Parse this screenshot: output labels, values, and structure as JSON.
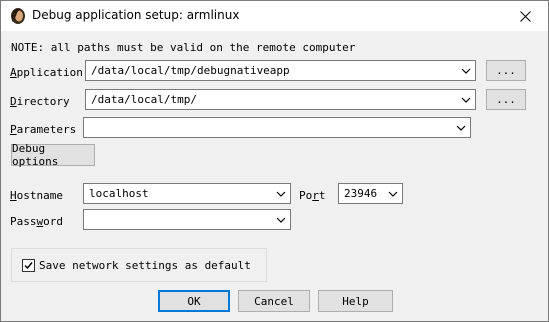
{
  "window": {
    "title": "Debug application setup: armlinux"
  },
  "note": "NOTE: all paths must be valid on the remote computer",
  "fields": {
    "application": {
      "label_key": "A",
      "label_rest": "pplication",
      "value": "/data/local/tmp/debugnativeapp",
      "browse_label": "..."
    },
    "directory": {
      "label_key": "D",
      "label_rest": "irectory",
      "value": "/data/local/tmp/",
      "browse_label": "..."
    },
    "parameters": {
      "label_key": "P",
      "label_rest": "arameters",
      "value": ""
    }
  },
  "debug_options_label": "Debug options",
  "network": {
    "hostname": {
      "label_key": "H",
      "label_rest": "ostname",
      "value": "localhost"
    },
    "port": {
      "label_pre": "Po",
      "label_key": "r",
      "label_post": "t",
      "value": "23946"
    },
    "password": {
      "label_pre": "Pass",
      "label_key": "w",
      "label_post": "ord",
      "value": ""
    }
  },
  "save_default": {
    "label": "Save network settings as default",
    "checked": true
  },
  "buttons": {
    "ok": "OK",
    "cancel": "Cancel",
    "help": "Help"
  }
}
